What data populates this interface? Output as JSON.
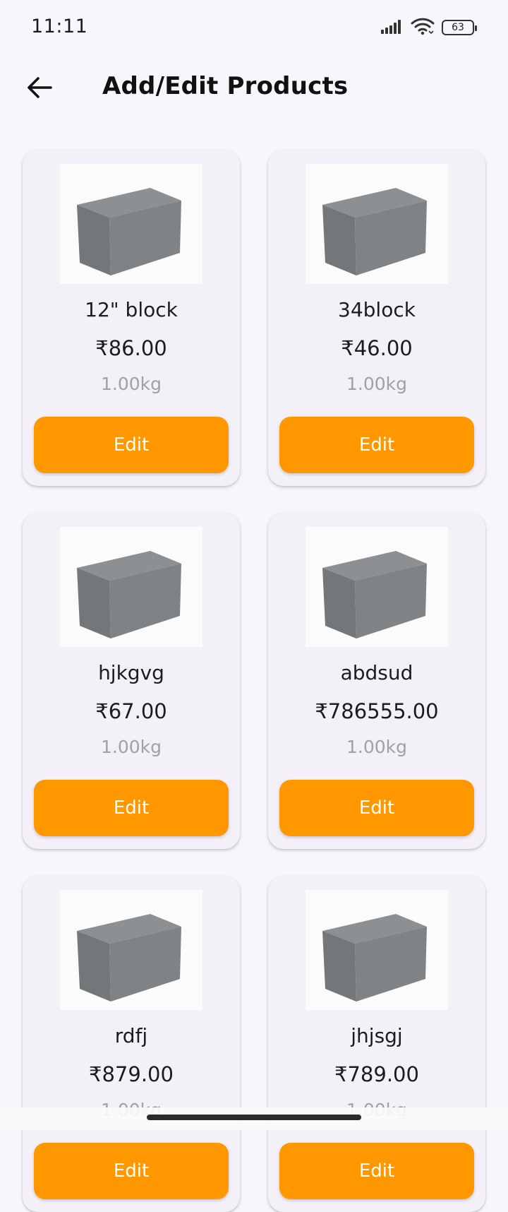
{
  "status_bar": {
    "time": "11:11",
    "battery": "63",
    "icons": [
      "signal-icon",
      "wifi-icon",
      "battery-icon"
    ]
  },
  "app_bar": {
    "back_icon": "arrow-left-icon",
    "title": "Add/Edit Products"
  },
  "products": [
    {
      "name": "12\" block",
      "price": "₹86.00",
      "weight": "1.00kg",
      "button": "Edit"
    },
    {
      "name": "34block",
      "price": "₹46.00",
      "weight": "1.00kg",
      "button": "Edit"
    },
    {
      "name": "hjkgvg",
      "price": "₹67.00",
      "weight": "1.00kg",
      "button": "Edit"
    },
    {
      "name": "abdsud",
      "price": "₹786555.00",
      "weight": "1.00kg",
      "button": "Edit"
    },
    {
      "name": "rdfj",
      "price": "₹879.00",
      "weight": "1.00kg",
      "button": "Edit"
    },
    {
      "name": "jhjsgj",
      "price": "₹789.00",
      "weight": "1.00kg",
      "button": "Edit"
    }
  ],
  "colors": {
    "background": "#f6f7fb",
    "card": "#f4f0f8",
    "accent": "#ff9800",
    "muted_text": "#a29fa6"
  }
}
